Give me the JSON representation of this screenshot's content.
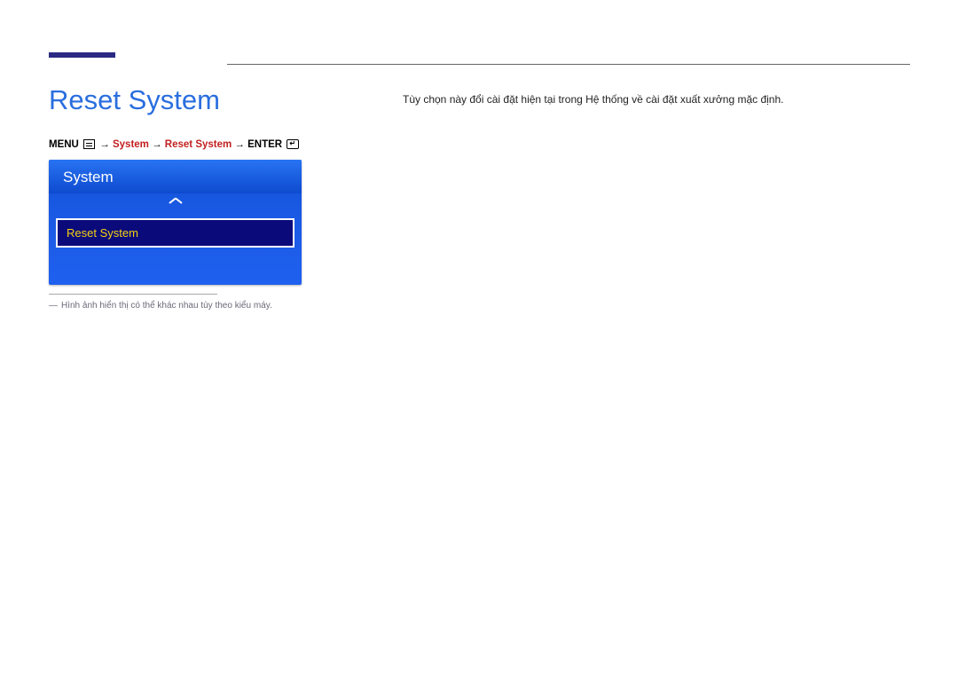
{
  "accent": "#2a2a82",
  "page_title": "Reset System",
  "body_text": "Tùy chọn này đổi cài đặt hiện tại trong Hệ thống về cài đặt xuất xưởng mặc định.",
  "breadcrumb": {
    "menu_label": "MENU",
    "arrow1": " → ",
    "system_label": "System",
    "arrow2": " → ",
    "reset_label": "Reset System",
    "arrow3": " → ",
    "enter_label": "ENTER"
  },
  "osd": {
    "header": "System",
    "selected_item": "Reset System"
  },
  "footnote": {
    "dash": "―",
    "text": "Hình ảnh hiển thị có thể khác nhau tùy theo kiểu máy."
  }
}
